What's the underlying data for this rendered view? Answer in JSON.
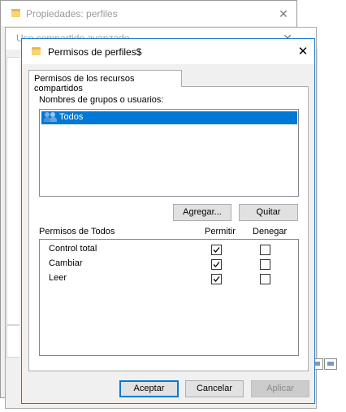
{
  "bg_window_1": {
    "title": "Propiedades: perfiles",
    "close": "✕"
  },
  "bg_window_2": {
    "title": "Uso compartido avanzado",
    "close": "✕"
  },
  "dialog": {
    "title": "Permisos de perfiles$",
    "close": "✕",
    "tab": "Permisos de los recursos compartidos",
    "groups_label": "Nombres de grupos o usuarios:",
    "groups": [
      {
        "name": "Todos",
        "selected": true
      }
    ],
    "add_button": "Agregar...",
    "remove_button": "Quitar",
    "permissions_label": "Permisos de Todos",
    "allow_header": "Permitir",
    "deny_header": "Denegar",
    "permissions": [
      {
        "name": "Control total",
        "allow": true,
        "deny": false
      },
      {
        "name": "Cambiar",
        "allow": true,
        "deny": false
      },
      {
        "name": "Leer",
        "allow": true,
        "deny": false
      }
    ],
    "ok_button": "Aceptar",
    "cancel_button": "Cancelar",
    "apply_button": "Aplicar"
  },
  "colors": {
    "accent": "#0078d7",
    "window_bg": "#f0f0f0",
    "folder": "#e8b84a"
  },
  "icons": {
    "folder": "folder-icon",
    "users": "users-group-icon",
    "check": "checkmark-icon"
  }
}
